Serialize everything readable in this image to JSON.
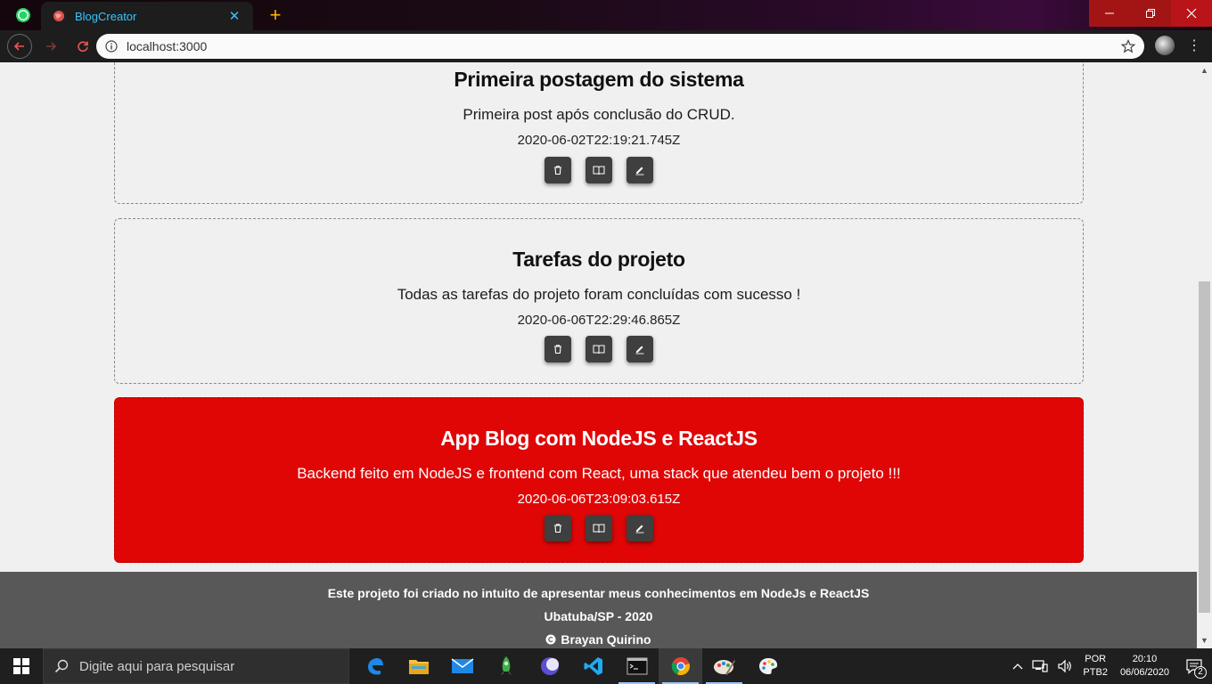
{
  "browser": {
    "tab_title": "BlogCreator",
    "tab_close": "✕",
    "new_tab": "+",
    "url": "localhost:3000"
  },
  "posts": [
    {
      "title": "Primeira postagem do sistema",
      "description": "Primeira post após conclusão do CRUD.",
      "date": "2020-06-02T22:19:21.745Z",
      "highlighted": false
    },
    {
      "title": "Tarefas do projeto",
      "description": "Todas as tarefas do projeto foram concluídas com sucesso !",
      "date": "2020-06-06T22:29:46.865Z",
      "highlighted": false
    },
    {
      "title": "App Blog com NodeJS e ReactJS",
      "description": "Backend feito em NodeJS e frontend com React, uma stack que atendeu bem o projeto !!!",
      "date": "2020-06-06T23:09:03.615Z",
      "highlighted": true
    }
  ],
  "footer": {
    "line1": "Este projeto foi criado no intuito de apresentar meus conhecimentos em NodeJs e ReactJS",
    "line2": "Ubatuba/SP - 2020",
    "line3": "Brayan Quirino"
  },
  "taskbar": {
    "search_placeholder": "Digite aqui para pesquisar",
    "lang_top": "POR",
    "lang_bottom": "PTB2",
    "time": "20:10",
    "date": "06/06/2020",
    "notifications": "2"
  },
  "colors": {
    "highlight": "#e00606",
    "footer": "#585858",
    "action_button": "#3f3f3f"
  }
}
